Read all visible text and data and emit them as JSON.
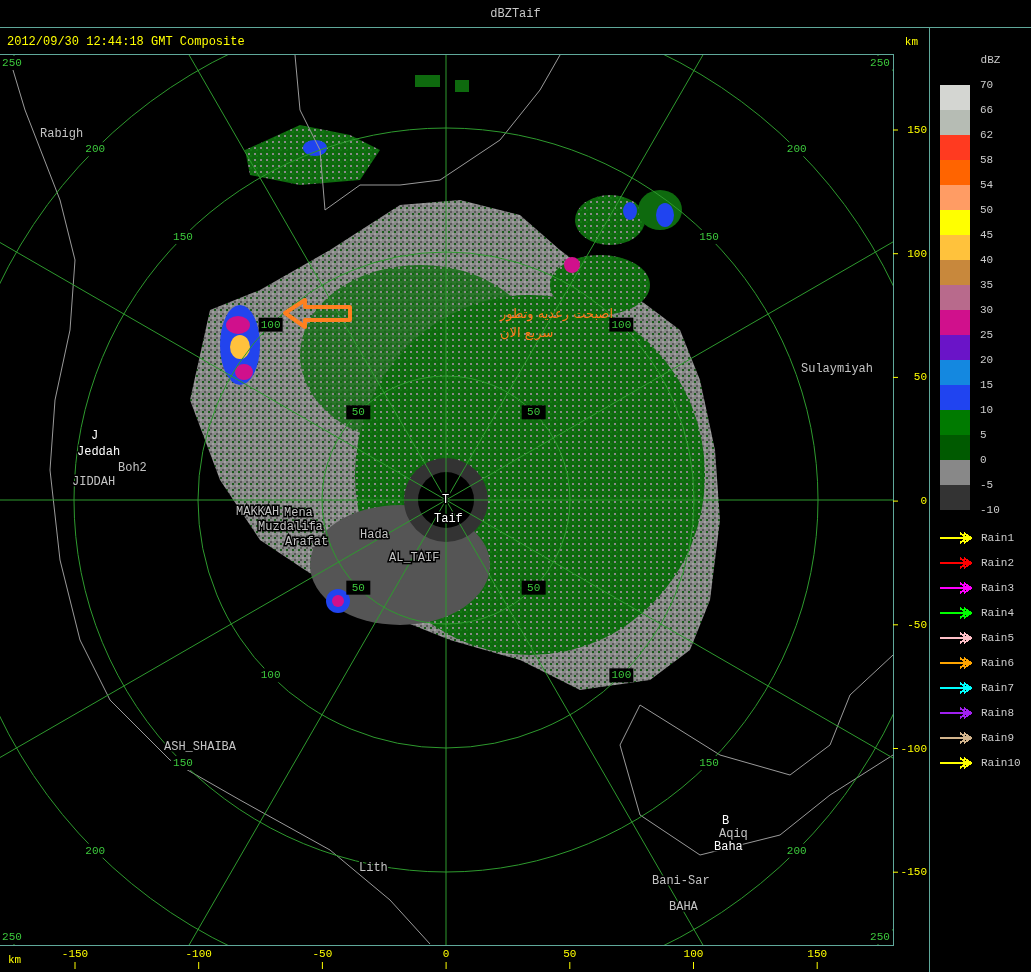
{
  "window": {
    "title": "dBZTaif"
  },
  "header": {
    "timestamp": "2012/09/30 12:44:18 GMT Composite",
    "unit": "km"
  },
  "map": {
    "range_rings": [
      {
        "labels": [
          "50",
          "50",
          "50",
          "50"
        ]
      },
      {
        "labels": [
          "100",
          "100",
          "100",
          "100"
        ]
      },
      {
        "labels": [
          "150",
          "150",
          "150",
          "150"
        ]
      },
      {
        "labels": [
          "200",
          "200",
          "200",
          "200"
        ]
      },
      {
        "labels": [
          "250",
          "250",
          "250",
          "250"
        ]
      }
    ],
    "places": [
      {
        "name": "Rabigh",
        "kind": "town"
      },
      {
        "name": "J",
        "kind": "site"
      },
      {
        "name": "Jeddah",
        "kind": "site"
      },
      {
        "name": "Boh2",
        "kind": "town"
      },
      {
        "name": "JIDDAH",
        "kind": "town"
      },
      {
        "name": "MAKKAH",
        "kind": "town"
      },
      {
        "name": "Mena",
        "kind": "town"
      },
      {
        "name": "Muzdalifa",
        "kind": "town"
      },
      {
        "name": "Arafat",
        "kind": "town"
      },
      {
        "name": "Hada",
        "kind": "town"
      },
      {
        "name": "AL_TAIF",
        "kind": "town"
      },
      {
        "name": "T",
        "kind": "site"
      },
      {
        "name": "Taif",
        "kind": "site"
      },
      {
        "name": "Sulaymiyah",
        "kind": "town"
      },
      {
        "name": "ASH_SHAIBA",
        "kind": "town"
      },
      {
        "name": "Lith",
        "kind": "town"
      },
      {
        "name": "B",
        "kind": "site"
      },
      {
        "name": "Aqiq",
        "kind": "town"
      },
      {
        "name": "Baha",
        "kind": "site"
      },
      {
        "name": "Bani-Sar",
        "kind": "town"
      },
      {
        "name": "BAHA",
        "kind": "town"
      }
    ],
    "annotation": {
      "lines": [
        "اصبحت رعديه وتطور",
        "سريع الان"
      ]
    }
  },
  "y_axis": {
    "ticks": [
      "150",
      "100",
      "50",
      "0",
      "-50",
      "-100",
      "-150"
    ]
  },
  "x_axis": {
    "unit": "km",
    "ticks": [
      "-150",
      "-100",
      "-50",
      "0",
      "50",
      "100",
      "150"
    ]
  },
  "legend": {
    "title": "dBZ",
    "bands": [
      {
        "color": "#d4d6d2"
      },
      {
        "color": "#b6bcb4"
      },
      {
        "color": "#ff3a20"
      },
      {
        "color": "#ff6400"
      },
      {
        "color": "#ff9c64"
      },
      {
        "color": "#ffff00"
      },
      {
        "color": "#ffc23c"
      },
      {
        "color": "#c8883c"
      },
      {
        "color": "#b86a8c"
      },
      {
        "color": "#d0108c"
      },
      {
        "color": "#6a14c8"
      },
      {
        "color": "#1488e0"
      },
      {
        "color": "#2044f0"
      },
      {
        "color": "#007a00"
      },
      {
        "color": "#005a00"
      },
      {
        "color": "#888888"
      },
      {
        "color": "#333333"
      }
    ],
    "scale_labels": [
      "70",
      "66",
      "62",
      "58",
      "54",
      "50",
      "45",
      "40",
      "35",
      "30",
      "25",
      "20",
      "15",
      "10",
      "5",
      "0",
      "-5",
      "-10"
    ],
    "tracks": [
      {
        "label": "Rain1",
        "color": "#ffff00"
      },
      {
        "label": "Rain2",
        "color": "#ff0000"
      },
      {
        "label": "Rain3",
        "color": "#ff00ff"
      },
      {
        "label": "Rain4",
        "color": "#00ff00"
      },
      {
        "label": "Rain5",
        "color": "#ffc0c8"
      },
      {
        "label": "Rain6",
        "color": "#ffa500"
      },
      {
        "label": "Rain7",
        "color": "#00ffff"
      },
      {
        "label": "Rain8",
        "color": "#a020f0"
      },
      {
        "label": "Rain9",
        "color": "#d2b48c"
      },
      {
        "label": "Rain10",
        "color": "#ffff00"
      }
    ]
  }
}
